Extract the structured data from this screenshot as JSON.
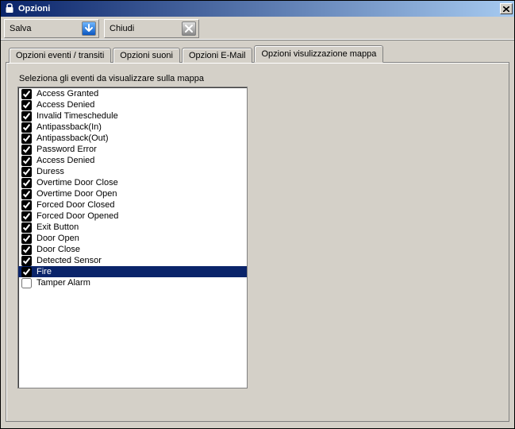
{
  "window": {
    "title": "Opzioni"
  },
  "toolbar": {
    "save_label": "Salva",
    "close_label": "Chiudi"
  },
  "tabs": [
    {
      "label": "Opzioni eventi / transiti"
    },
    {
      "label": "Opzioni suoni"
    },
    {
      "label": "Opzioni E-Mail"
    },
    {
      "label": "Opzioni visulizzazione mappa"
    }
  ],
  "panel": {
    "label": "Seleziona gli eventi da visualizzare sulla mappa"
  },
  "events": [
    {
      "label": "Access Granted",
      "checked": true,
      "selected": false
    },
    {
      "label": "Access Denied",
      "checked": true,
      "selected": false
    },
    {
      "label": "Invalid Timeschedule",
      "checked": true,
      "selected": false
    },
    {
      "label": "Antipassback(In)",
      "checked": true,
      "selected": false
    },
    {
      "label": "Antipassback(Out)",
      "checked": true,
      "selected": false
    },
    {
      "label": "Password Error",
      "checked": true,
      "selected": false
    },
    {
      "label": "Access Denied",
      "checked": true,
      "selected": false
    },
    {
      "label": "Duress",
      "checked": true,
      "selected": false
    },
    {
      "label": "Overtime Door Close",
      "checked": true,
      "selected": false
    },
    {
      "label": "Overtime Door Open",
      "checked": true,
      "selected": false
    },
    {
      "label": "Forced Door Closed",
      "checked": true,
      "selected": false
    },
    {
      "label": "Forced Door Opened",
      "checked": true,
      "selected": false
    },
    {
      "label": "Exit Button",
      "checked": true,
      "selected": false
    },
    {
      "label": "Door Open",
      "checked": true,
      "selected": false
    },
    {
      "label": "Door Close",
      "checked": true,
      "selected": false
    },
    {
      "label": "Detected Sensor",
      "checked": true,
      "selected": false
    },
    {
      "label": "Fire",
      "checked": true,
      "selected": true
    },
    {
      "label": "Tamper Alarm",
      "checked": false,
      "selected": false
    }
  ]
}
